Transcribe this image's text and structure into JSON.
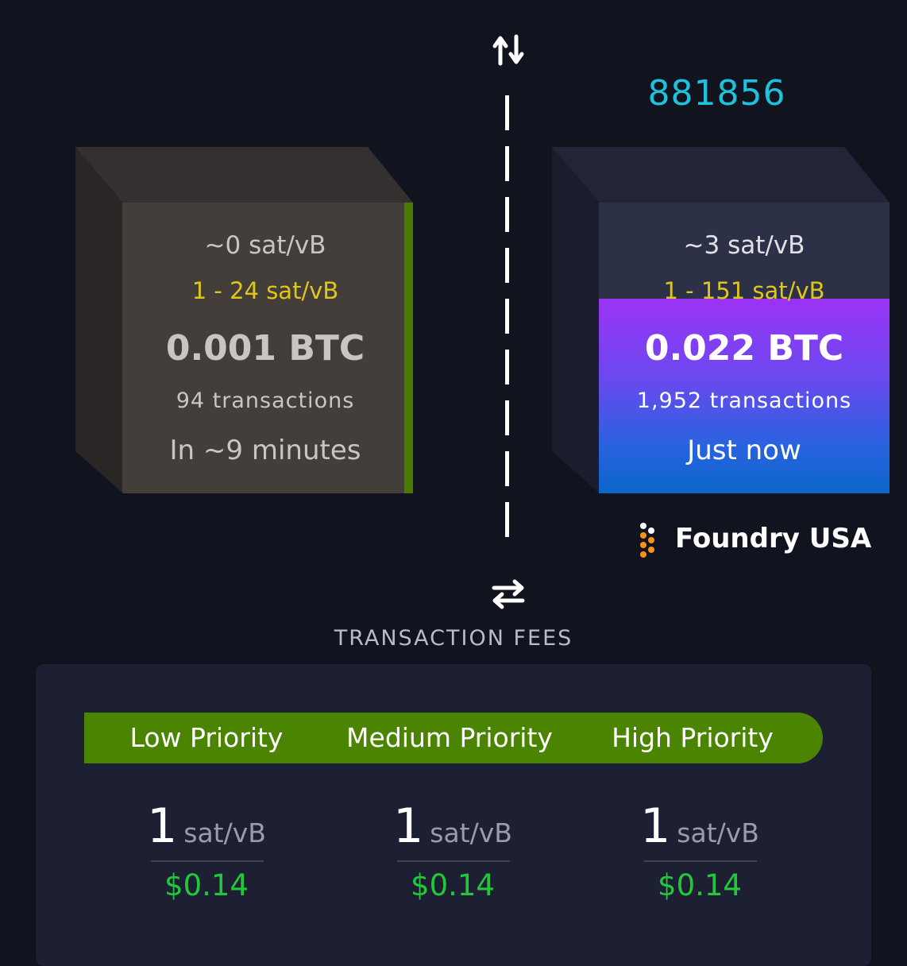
{
  "divider": {
    "top_icon": "up-down-arrows-icon",
    "bottom_icon": "swap-arrows-icon"
  },
  "pending_block": {
    "median_fee": "~0 sat/vB",
    "fee_range": "1 - 24 sat/vB",
    "total_fees": "0.001 BTC",
    "tx_count": "94 transactions",
    "eta": "In ~9 minutes"
  },
  "mined_block": {
    "height": "881856",
    "median_fee": "~3 sat/vB",
    "fee_range": "1 - 151 sat/vB",
    "total_fees": "0.022 BTC",
    "tx_count": "1,952 transactions",
    "time": "Just now",
    "fill_fraction": 0.67,
    "miner": {
      "name": "Foundry USA",
      "icon": "foundry-logo-icon"
    }
  },
  "fees": {
    "title": "TRANSACTION FEES",
    "priorities": [
      {
        "label": "Low Priority",
        "rate": "1",
        "unit": "sat/vB",
        "usd": "$0.14"
      },
      {
        "label": "Medium Priority",
        "rate": "1",
        "unit": "sat/vB",
        "usd": "$0.14"
      },
      {
        "label": "High Priority",
        "rate": "1",
        "unit": "sat/vB",
        "usd": "$0.14"
      }
    ]
  },
  "colors": {
    "background": "#11131f",
    "block_height": "#1bc3dd",
    "fee_range": "#e1c61a",
    "priority_bar": "#4a8400",
    "usd": "#22c83a",
    "miner_logo": "#f7931a"
  }
}
